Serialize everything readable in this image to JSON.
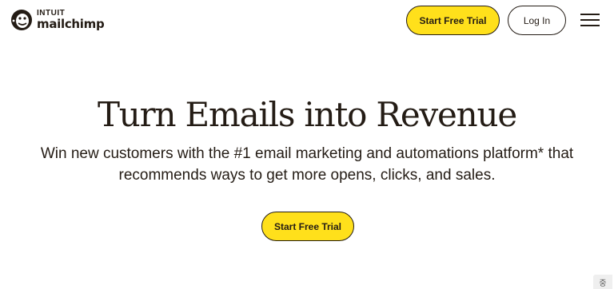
{
  "header": {
    "logo": {
      "brand_top": "INTUIT",
      "brand_bottom": "mailchimp",
      "icon": "freddie-logo-icon"
    },
    "start_trial_label": "Start Free Trial",
    "login_label": "Log In",
    "menu_icon": "hamburger-menu-icon"
  },
  "hero": {
    "title": "Turn Emails into Revenue",
    "subtitle": "Win new customers with the #1 email marketing and automations platform* that recommends ways to get more opens, clicks, and sales.",
    "cta_label": "Start Free Trial"
  },
  "corner_widget": {
    "glyph": "중",
    "icon": "accessibility-widget-icon"
  },
  "colors": {
    "accent": "#ffe01b",
    "text": "#241c15",
    "background": "#ffffff"
  }
}
